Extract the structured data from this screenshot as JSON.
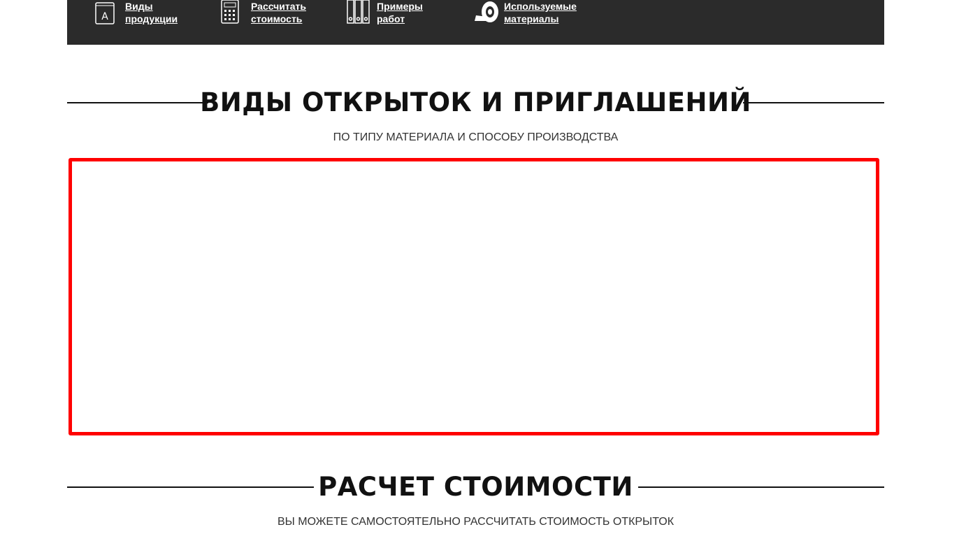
{
  "nav": {
    "items": [
      {
        "label": "Виды\nпродукции",
        "icon": "book-a-icon"
      },
      {
        "label": "Рассчитать\nстоимость",
        "icon": "calculator-icon"
      },
      {
        "label": "Примеры\nработ",
        "icon": "binders-icon"
      },
      {
        "label": "Используемые\nматериалы",
        "icon": "paper-roll-icon"
      }
    ]
  },
  "section1": {
    "title": "ВИДЫ ОТКРЫТОК И ПРИГЛАШЕНИЙ",
    "subtitle": "ПО ТИПУ МАТЕРИАЛА И СПОСОБУ ПРОИЗВОДСТВА"
  },
  "section2": {
    "title": "РАСЧЕТ СТОИМОСТИ",
    "subtitle": "ВЫ МОЖЕТЕ САМОСТОЯТЕЛЬНО РАССЧИТАТЬ СТОИМОСТЬ ОТКРЫТОК"
  },
  "colors": {
    "topbar": "#2b2b2b",
    "frame_border": "#ff0000"
  }
}
